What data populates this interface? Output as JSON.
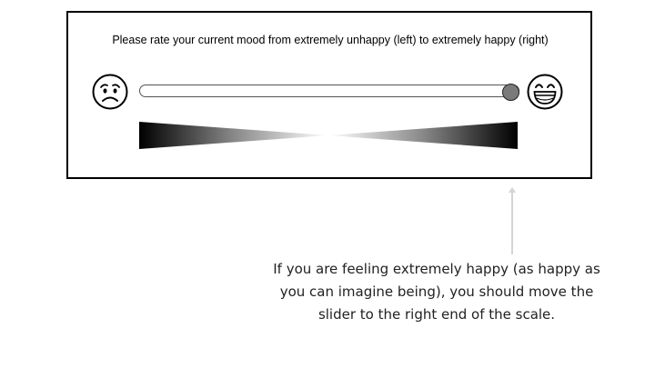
{
  "survey": {
    "prompt": "Please rate your current mood from extremely unhappy (left) to extremely happy (right)",
    "left_icon": "sad-face-icon",
    "right_icon": "happy-face-icon",
    "slider": {
      "min_label": "extremely unhappy",
      "max_label": "extremely happy",
      "value_fraction": 1.0
    }
  },
  "instruction": {
    "text": "If you are feeling extremely happy (as happy as you can imagine being), you should move the slider to the right end of the scale."
  },
  "colors": {
    "thumb": "#7a7a7a",
    "border": "#000000",
    "pointer": "#d4d4d4"
  }
}
